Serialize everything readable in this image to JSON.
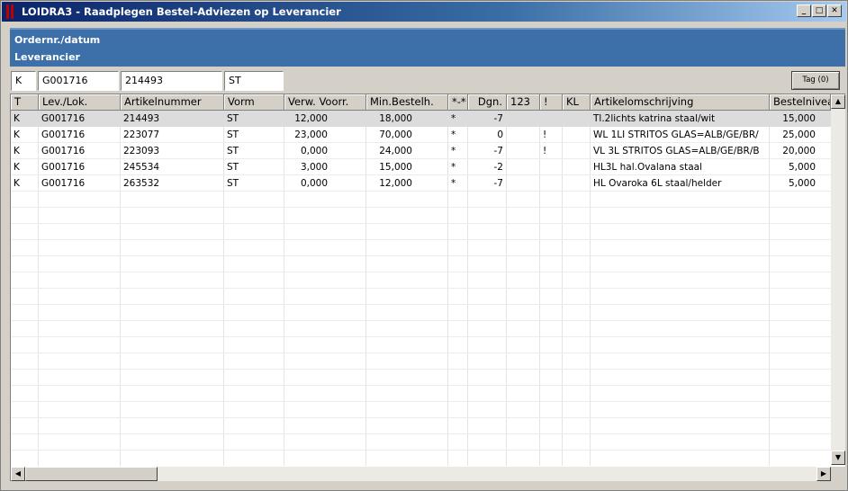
{
  "window": {
    "title": "LOIDRA3 - Raadplegen Bestel-Adviezen op Leverancier",
    "minimize_glyph": "_",
    "maximize_glyph": "□",
    "close_glyph": "✕"
  },
  "info_panel": {
    "line1": "Ordernr./datum",
    "line2": "Leverancier"
  },
  "filters": {
    "type": "K",
    "supplier": "G001716",
    "article": "214493",
    "form": "ST"
  },
  "tag_button": "Tag (0)",
  "columns": [
    "T",
    "Lev./Lok.",
    "Artikelnummer",
    "Vorm",
    "Verw. Voorr.",
    "Min.Bestelh.",
    "*-*",
    "Dgn.",
    "123",
    "!",
    "KL",
    "Artikelomschrijving",
    "Bestelniveau"
  ],
  "rows": [
    [
      "K",
      "G001716",
      "214493",
      "ST",
      "12,000",
      "18,000",
      "*",
      "-7",
      "",
      "",
      "",
      "Tl.2lichts katrina staal/wit",
      "15,000"
    ],
    [
      "K",
      "G001716",
      "223077",
      "ST",
      "23,000",
      "70,000",
      "*",
      "0",
      "",
      "!",
      "",
      "WL 1LI STRITOS GLAS=ALB/GE/BR/",
      "25,000"
    ],
    [
      "K",
      "G001716",
      "223093",
      "ST",
      "0,000",
      "24,000",
      "*",
      "-7",
      "",
      "!",
      "",
      "VL 3L STRITOS GLAS=ALB/GE/BR/B",
      "20,000"
    ],
    [
      "K",
      "G001716",
      "245534",
      "ST",
      "3,000",
      "15,000",
      "*",
      "-2",
      "",
      "",
      "",
      "HL3L hal.Ovalana staal",
      "5,000"
    ],
    [
      "K",
      "G001716",
      "263532",
      "ST",
      "0,000",
      "12,000",
      "*",
      "-7",
      "",
      "",
      "",
      "HL Ovaroka 6L staal/helder",
      "5,000"
    ]
  ],
  "scroll": {
    "up_arrow": "▲",
    "down_arrow": "▼",
    "left_arrow": "◀",
    "right_arrow": "▶"
  }
}
